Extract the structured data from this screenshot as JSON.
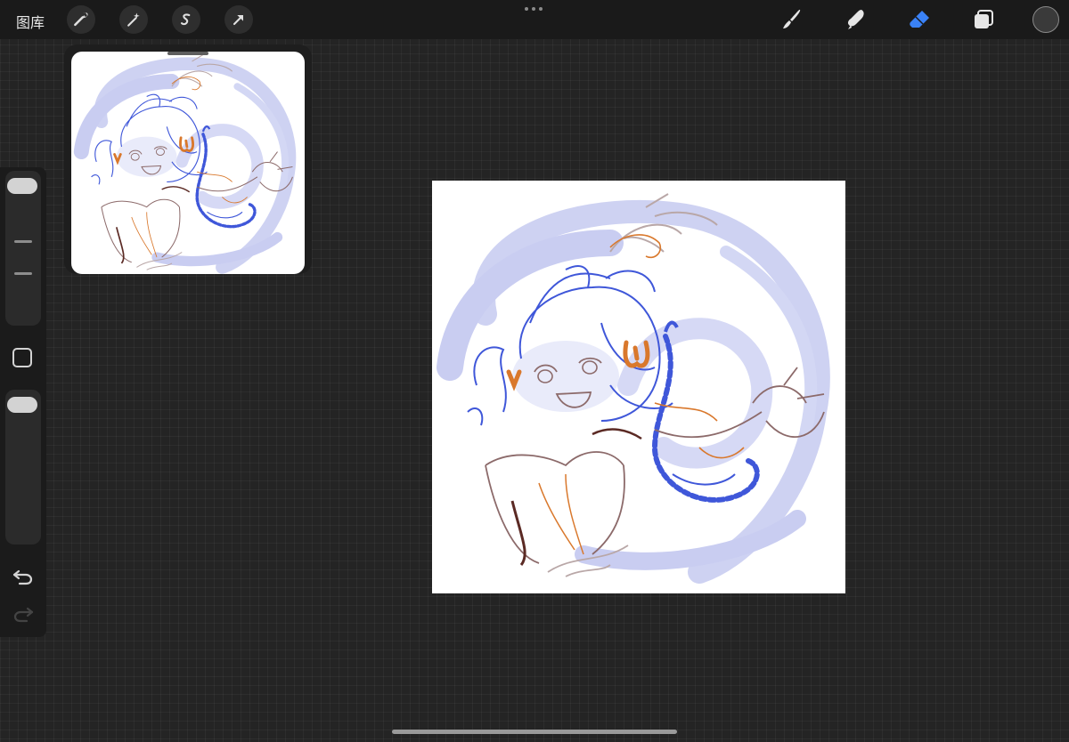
{
  "topbar": {
    "gallery_label": "图库",
    "left_tools": [
      {
        "name": "actions",
        "icon": "wrench-icon"
      },
      {
        "name": "adjustments",
        "icon": "magic-wand-icon"
      },
      {
        "name": "selection",
        "icon": "selection-s-icon"
      },
      {
        "name": "transform",
        "icon": "arrow-cursor-icon"
      }
    ],
    "right_tools": [
      {
        "name": "brush",
        "icon": "brush-icon",
        "active": false
      },
      {
        "name": "smudge",
        "icon": "smudge-finger-icon",
        "active": false
      },
      {
        "name": "eraser",
        "icon": "eraser-icon",
        "active": true
      },
      {
        "name": "layers",
        "icon": "layers-icon",
        "active": false
      }
    ],
    "current_color": "#3a3a3a",
    "active_tool_color": "#3a82f7"
  },
  "sidebar": {
    "brush_size": 0.1,
    "opacity": 0.1
  },
  "reference": {
    "visible": true
  },
  "colors": {
    "background": "#242424",
    "canvas": "#ffffff",
    "sketch_blue": "#3f57d9",
    "sketch_lavender": "#c9cdf1",
    "sketch_orange": "#d9782c",
    "sketch_brown": "#8c6a6a"
  }
}
